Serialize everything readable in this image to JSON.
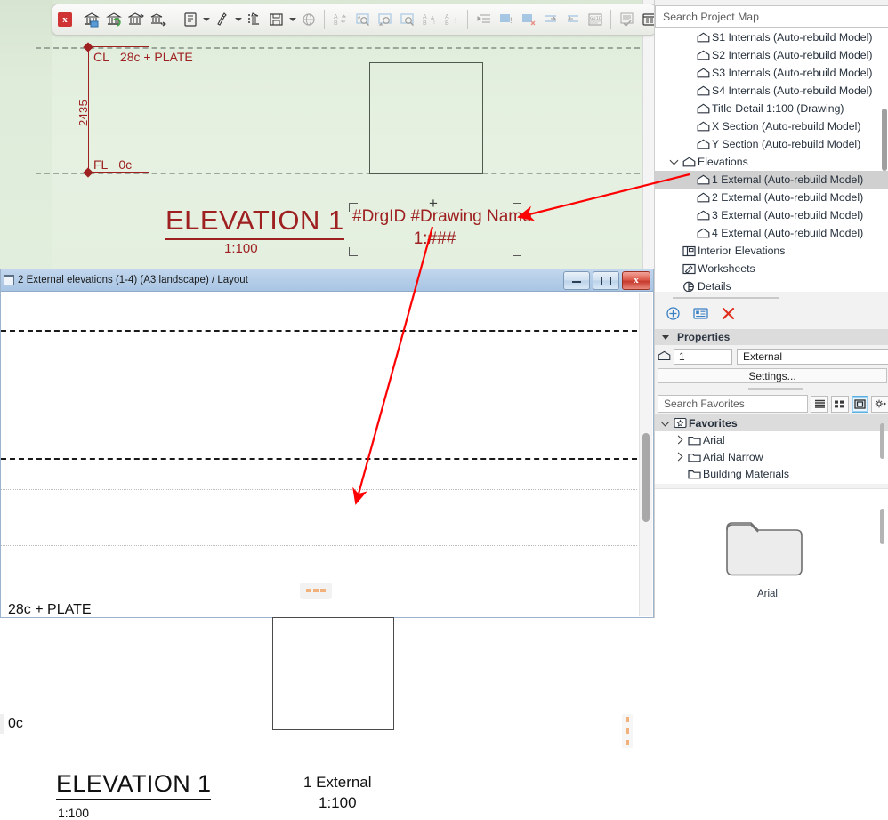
{
  "toolbar": {
    "close_label": "x",
    "buttons": [
      {
        "name": "publish-model-icon",
        "glyph": "bank"
      },
      {
        "name": "refresh-model-icon",
        "glyph": "bank-refresh"
      },
      {
        "name": "place-drawing-icon",
        "glyph": "bank-place"
      },
      {
        "name": "update-drawing-icon",
        "glyph": "bank-update"
      },
      {
        "name": "new-layout-icon",
        "glyph": "doc"
      },
      {
        "name": "master-layout-icon",
        "glyph": "pen"
      },
      {
        "name": "layout-book-icon",
        "glyph": "list"
      },
      {
        "name": "save-icon",
        "glyph": "save"
      },
      {
        "name": "publish-web-icon",
        "glyph": "globe"
      },
      {
        "name": "autotext-icon",
        "glyph": "ab"
      },
      {
        "name": "find-drawing-icon",
        "glyph": "find1"
      },
      {
        "name": "find-drawing-back-icon",
        "glyph": "find2"
      },
      {
        "name": "find-drawing-fwd-icon",
        "glyph": "find3"
      },
      {
        "name": "rename-icon",
        "glyph": "ab1"
      },
      {
        "name": "rename-alt-icon",
        "glyph": "ab2"
      },
      {
        "name": "indent-icon",
        "glyph": "indent"
      },
      {
        "name": "mark-blue-icon",
        "glyph": "mark1"
      },
      {
        "name": "unmark-blue-icon",
        "glyph": "mark2"
      },
      {
        "name": "move-right-icon",
        "glyph": "mvr"
      },
      {
        "name": "move-left-icon",
        "glyph": "mvl"
      },
      {
        "name": "guid-icon",
        "glyph": "guid"
      },
      {
        "name": "check-layout-icon",
        "glyph": "checklist"
      },
      {
        "name": "table-icon",
        "glyph": "table"
      },
      {
        "name": "settings-list-icon",
        "glyph": "listgear"
      },
      {
        "name": "people-icon",
        "glyph": "people"
      },
      {
        "name": "people-alt-icon",
        "glyph": "people2"
      }
    ]
  },
  "model_view": {
    "level_top_tag": "CL",
    "level_top_name": "28c + PLATE",
    "level_bottom_tag": "FL",
    "level_bottom_name": "0c",
    "dimension": "2435",
    "elevation_title": "ELEVATION 1",
    "elevation_scale": "1:100",
    "drawing_placeholder_line1": "#DrgID #Drawing Name",
    "drawing_placeholder_line2": "1:###"
  },
  "layout_window": {
    "title": "2 External elevations (1-4) (A3 landscape) / Layout",
    "min_label": "minimize",
    "max_label": "maximize",
    "close_label": "x",
    "level_top_name": "28c + PLATE",
    "level_bottom_name": "0c",
    "elevation_title": "ELEVATION 1",
    "elevation_scale": "1:100",
    "drawing_name": "1 External",
    "drawing_scale": "1:100"
  },
  "right_panel": {
    "search_placeholder": "Search Project Map",
    "project_tree": [
      {
        "label": "S1 Internals (Auto-rebuild Model)",
        "icon": "elevation-marker-icon",
        "indent": 2,
        "selected": false,
        "arrow": ""
      },
      {
        "label": "S2 Internals (Auto-rebuild Model)",
        "icon": "elevation-marker-icon",
        "indent": 2,
        "selected": false,
        "arrow": ""
      },
      {
        "label": "S3 Internals (Auto-rebuild Model)",
        "icon": "elevation-marker-icon",
        "indent": 2,
        "selected": false,
        "arrow": ""
      },
      {
        "label": "S4 Internals (Auto-rebuild Model)",
        "icon": "elevation-marker-icon",
        "indent": 2,
        "selected": false,
        "arrow": ""
      },
      {
        "label": "Title Detail 1:100 (Drawing)",
        "icon": "elevation-marker-icon",
        "indent": 2,
        "selected": false,
        "arrow": ""
      },
      {
        "label": "X Section (Auto-rebuild Model)",
        "icon": "elevation-marker-icon",
        "indent": 2,
        "selected": false,
        "arrow": ""
      },
      {
        "label": "Y Section (Auto-rebuild Model)",
        "icon": "elevation-marker-icon",
        "indent": 2,
        "selected": false,
        "arrow": ""
      },
      {
        "label": "Elevations",
        "icon": "elevation-marker-icon",
        "indent": 1,
        "selected": false,
        "arrow": "open"
      },
      {
        "label": "1 External (Auto-rebuild Model)",
        "icon": "elevation-marker-icon",
        "indent": 2,
        "selected": true,
        "arrow": ""
      },
      {
        "label": "2 External (Auto-rebuild Model)",
        "icon": "elevation-marker-icon",
        "indent": 2,
        "selected": false,
        "arrow": ""
      },
      {
        "label": "3 External (Auto-rebuild Model)",
        "icon": "elevation-marker-icon",
        "indent": 2,
        "selected": false,
        "arrow": ""
      },
      {
        "label": "4 External (Auto-rebuild Model)",
        "icon": "elevation-marker-icon",
        "indent": 2,
        "selected": false,
        "arrow": ""
      },
      {
        "label": "Interior Elevations",
        "icon": "interior-elevation-icon",
        "indent": 1,
        "selected": false,
        "arrow": ""
      },
      {
        "label": "Worksheets",
        "icon": "worksheet-icon",
        "indent": 1,
        "selected": false,
        "arrow": ""
      },
      {
        "label": "Details",
        "icon": "detail-icon",
        "indent": 1,
        "selected": false,
        "arrow": ""
      }
    ],
    "prop_toolbar": [
      {
        "name": "add-icon",
        "glyph": "plus-circle",
        "color": "#3a7fc4"
      },
      {
        "name": "rename-settings-icon",
        "glyph": "card",
        "color": "#3a7fc4"
      },
      {
        "name": "delete-icon",
        "glyph": "x-mark",
        "color": "#e03020"
      }
    ],
    "properties_header": "Properties",
    "property_id": "1",
    "property_name": "External",
    "settings_button": "Settings...",
    "favorites_search_placeholder": "Search Favorites",
    "view_buttons": [
      {
        "name": "list-view-button",
        "active": false
      },
      {
        "name": "grid-view-button",
        "active": false
      },
      {
        "name": "large-icon-view-button",
        "active": true
      },
      {
        "name": "favorites-options-button",
        "active": false
      }
    ],
    "favorites_tree": [
      {
        "label": "Favorites",
        "indent": 0,
        "arrow": "open",
        "head": true,
        "icon": "favorites-star-icon"
      },
      {
        "label": "Arial",
        "indent": 1,
        "arrow": "closed",
        "head": false,
        "icon": "folder-icon"
      },
      {
        "label": "Arial Narrow",
        "indent": 1,
        "arrow": "closed",
        "head": false,
        "icon": "folder-icon"
      },
      {
        "label": "Building Materials",
        "indent": 1,
        "arrow": "",
        "head": false,
        "icon": "folder-icon"
      }
    ],
    "preview_label": "Arial"
  },
  "colors": {
    "model_bg": "#e4efe0",
    "annotation_red": "#9e2020",
    "arrow_red": "#ff0000",
    "selection_gray": "#d0d0d0",
    "titlebar_blue": "#b4cde8"
  }
}
